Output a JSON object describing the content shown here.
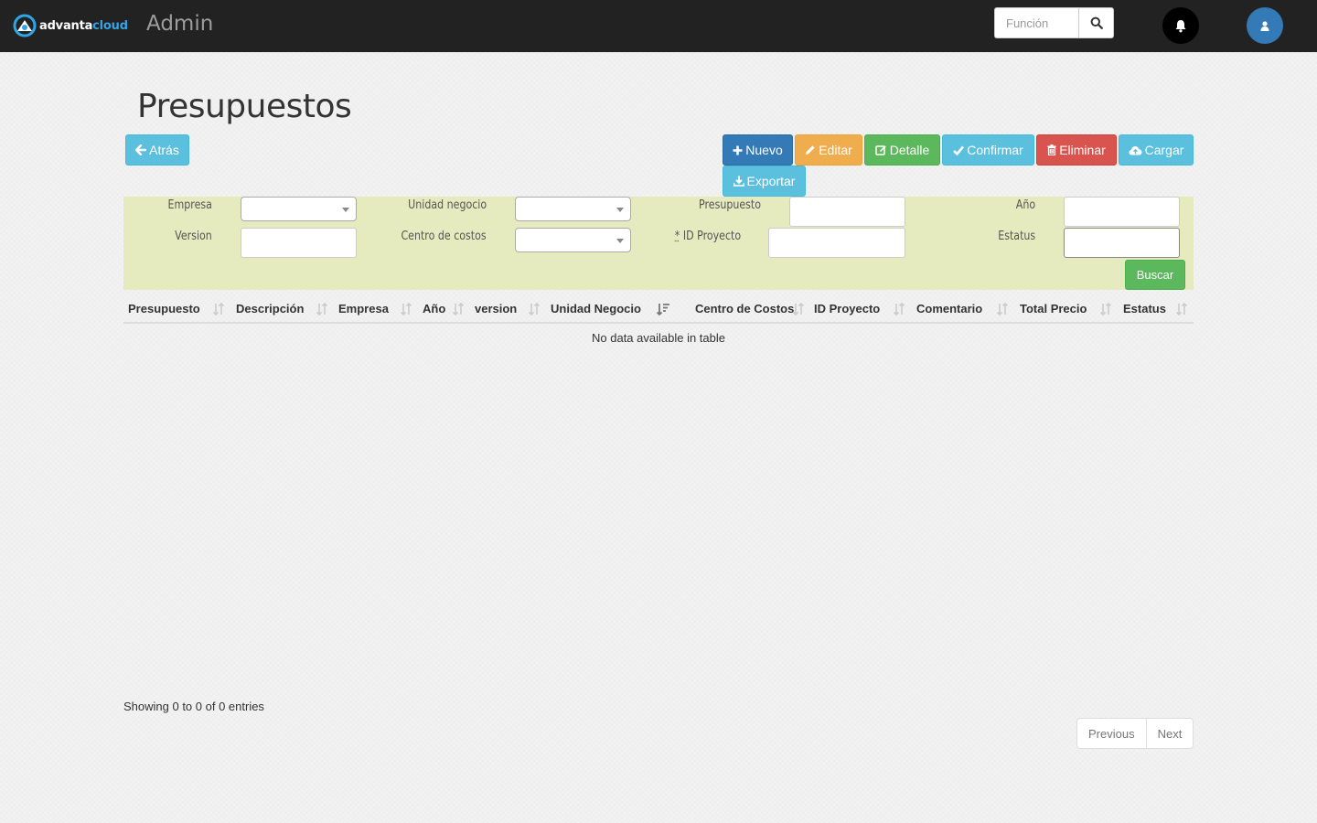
{
  "navbar": {
    "logo_part1": "advanta",
    "logo_part2": "cloud",
    "title": "Admin",
    "search_placeholder": "Función",
    "search_icon": "search-icon",
    "notification_icon": "bell-icon",
    "user_icon": "user-icon"
  },
  "page": {
    "title": "Presupuestos"
  },
  "toolbar": {
    "back": "Atrás",
    "new": "Nuevo",
    "edit": "Editar",
    "detail": "Detalle",
    "confirm": "Confirmar",
    "delete": "Eliminar",
    "upload": "Cargar",
    "export": "Exportar"
  },
  "filters": {
    "empresa_label": "Empresa",
    "unidad_label": "Unidad negocio",
    "presupuesto_label": "Presupuesto",
    "anio_label": "Año",
    "version_label": "Version",
    "centro_label": "Centro de costos",
    "id_proyecto_label": "ID Proyecto",
    "required_mark": "*",
    "estatus_label": "Estatus",
    "search_button": "Buscar"
  },
  "table": {
    "columns": [
      "Presupuesto",
      "Descripción",
      "Empresa",
      "Año",
      "version",
      "Unidad Negocio",
      "Centro de Costos",
      "ID Proyecto",
      "Comentario",
      "Total Precio",
      "Estatus"
    ],
    "sorted_column": "Unidad Negocio",
    "empty_message": "No data available in table",
    "info": "Showing 0 to 0 of 0 entries",
    "previous": "Previous",
    "next": "Next"
  },
  "colors": {
    "navbar": "#222222",
    "filter_panel": "#e6ebbf",
    "info": "#5bc0de",
    "primary": "#337ab7",
    "warning": "#f0ad4e",
    "success": "#5cb85c",
    "danger": "#d9534f"
  }
}
